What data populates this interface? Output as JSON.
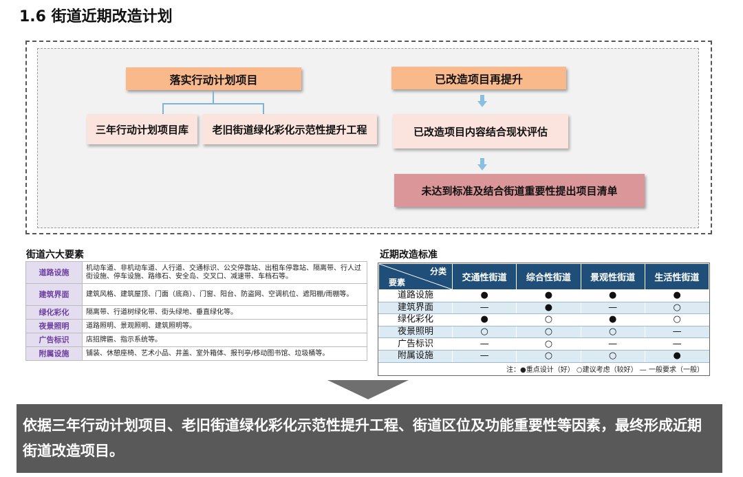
{
  "title": "1.6 街道近期改造计划",
  "flow": {
    "left_header": "落实行动计划项目",
    "left_child_1": "三年行动计划项目库",
    "left_child_2": "老旧街道绿化彩化示范性提升工程",
    "right_header": "已改造项目再提升",
    "right_step_2": "已改造项目内容结合现状评估",
    "right_step_3": "未达到标准及结合街道重要性提出项目清单"
  },
  "elements": {
    "heading": "街道六大要素",
    "rows": [
      {
        "key": "道路设施",
        "value": "机动车道、非机动车道、人行道、交通标识、公交停靠站、出租车停靠站、隔离带、行人过街设施、停车设施、路缘石、安全岛、交叉口、减速带、车档石等。"
      },
      {
        "key": "建筑界面",
        "value": "建筑风格、建筑屋顶、门面（底商）、门窗、阳台、防盗网、空调机位、遮阳棚/雨棚等。"
      },
      {
        "key": "绿化彩化",
        "value": "隔离带、行道树绿化带、街头绿地、垂直绿化等。"
      },
      {
        "key": "夜景照明",
        "value": "道路照明、景观照明、建筑照明等。"
      },
      {
        "key": "广告标识",
        "value": "店招牌匾、指示系统等。"
      },
      {
        "key": "附属设施",
        "value": "铺装、休憩座椅、艺术小品、井盖、室外箱体、报刊亭/移动图书馆、垃圾桶等。"
      }
    ]
  },
  "standards": {
    "heading": "近期改造标准",
    "corner_top": "分类",
    "corner_bottom": "要素",
    "columns": [
      "交通性街道",
      "综合性街道",
      "景观性街道",
      "生活性街道"
    ],
    "rows": [
      {
        "label": "道路设施",
        "cells": [
          "●",
          "●",
          "●",
          "●"
        ]
      },
      {
        "label": "建筑界面",
        "cells": [
          "—",
          "●",
          "—",
          "○"
        ]
      },
      {
        "label": "绿化彩化",
        "cells": [
          "●",
          "○",
          "●",
          "○"
        ]
      },
      {
        "label": "夜景照明",
        "cells": [
          "○",
          "○",
          "○",
          "—"
        ]
      },
      {
        "label": "广告标识",
        "cells": [
          "—",
          "○",
          "—",
          "—"
        ]
      },
      {
        "label": "附属设施",
        "cells": [
          "—",
          "○",
          "○",
          "●"
        ]
      }
    ],
    "legend": "注：●重点设计（好）    ○建议考虑（较好）    — 一般要求（一般）"
  },
  "conclusion": "依据三年行动计划项目、老旧街道绿化彩化示范性提升工程、街道区位及功能重要性等因素，最终形成近期街道改造项目。"
}
